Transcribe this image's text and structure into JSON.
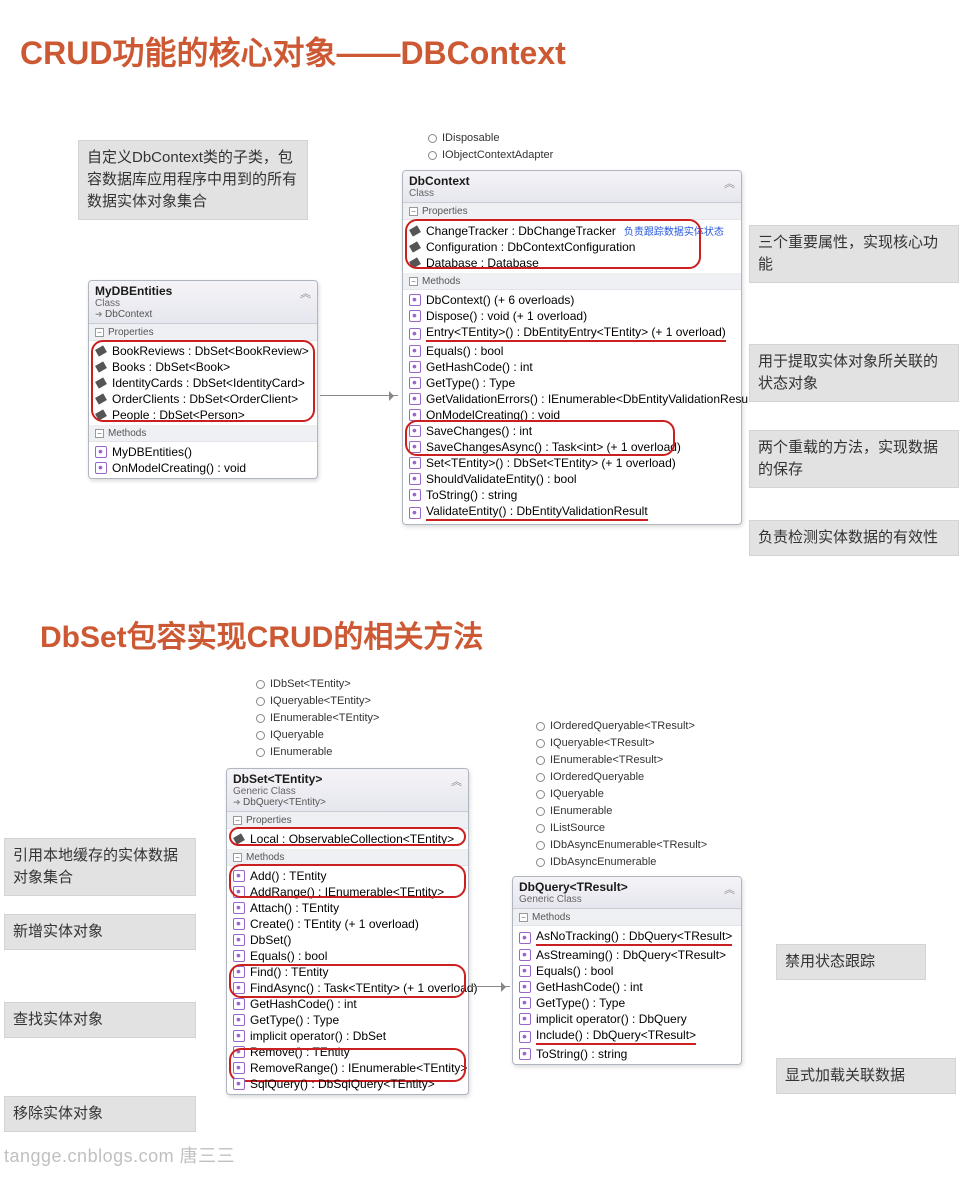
{
  "titles": {
    "main1": "CRUD功能的核心对象——DBContext",
    "main2": "DbSet包容实现CRUD的相关方法"
  },
  "footer": "tangge.cnblogs.com 唐三三",
  "callouts": {
    "c1": "自定义DbContext类的子类，包容数据库应用程序中用到的所有数据实体对象集合",
    "c2": "三个重要属性，实现核心功能",
    "c3": "用于提取实体对象所关联的状态对象",
    "c4": "两个重载的方法，实现数据的保存",
    "c5": "负责检测实体数据的有效性",
    "c6": "引用本地缓存的实体数据对象集合",
    "c7": "新增实体对象",
    "c8": "查找实体对象",
    "c9": "移除实体对象",
    "c10": "禁用状态跟踪",
    "c11": "显式加载关联数据"
  },
  "interfaces": {
    "dbcontext": [
      "IDisposable",
      "IObjectContextAdapter"
    ],
    "dbset": [
      "IDbSet<TEntity>",
      "IQueryable<TEntity>",
      "IEnumerable<TEntity>",
      "IQueryable",
      "IEnumerable"
    ],
    "dbquery": [
      "IOrderedQueryable<TResult>",
      "IQueryable<TResult>",
      "IEnumerable<TResult>",
      "IOrderedQueryable",
      "IQueryable",
      "IEnumerable",
      "IListSource",
      "IDbAsyncEnumerable<TResult>",
      "IDbAsyncEnumerable"
    ]
  },
  "uml": {
    "sectionProps": "Properties",
    "sectionMethods": "Methods",
    "myDbEntities": {
      "name": "MyDBEntities",
      "type": "Class",
      "inherits": "DbContext",
      "props": [
        "BookReviews : DbSet<BookReview>",
        "Books : DbSet<Book>",
        "IdentityCards : DbSet<IdentityCard>",
        "OrderClients : DbSet<OrderClient>",
        "People : DbSet<Person>"
      ],
      "methods": [
        "MyDBEntities()",
        "OnModelCreating() : void"
      ]
    },
    "dbContext": {
      "name": "DbContext",
      "type": "Class",
      "trackerAnno": "负责跟踪数据实体状态",
      "props": [
        "ChangeTracker : DbChangeTracker",
        "Configuration : DbContextConfiguration",
        "Database : Database"
      ],
      "methods": [
        "DbContext() (+ 6 overloads)",
        "Dispose() : void (+ 1 overload)",
        "Entry<TEntity>() : DbEntityEntry<TEntity> (+ 1 overload)",
        "Equals() : bool",
        "GetHashCode() : int",
        "GetType() : Type",
        "GetValidationErrors() : IEnumerable<DbEntityValidationResu",
        "OnModelCreating() : void",
        "SaveChanges() : int",
        "SaveChangesAsync() : Task<int> (+ 1 overload)",
        "Set<TEntity>() : DbSet<TEntity> (+ 1 overload)",
        "ShouldValidateEntity() : bool",
        "ToString() : string",
        "ValidateEntity() : DbEntityValidationResult"
      ]
    },
    "dbSet": {
      "name": "DbSet<TEntity>",
      "type": "Generic Class",
      "inherits": "DbQuery<TEntity>",
      "props": [
        "Local : ObservableCollection<TEntity>"
      ],
      "methods": [
        "Add() : TEntity",
        "AddRange() : IEnumerable<TEntity>",
        "Attach() : TEntity",
        "Create() : TEntity (+ 1 overload)",
        "DbSet()",
        "Equals() : bool",
        "Find() : TEntity",
        "FindAsync() : Task<TEntity> (+ 1 overload)",
        "GetHashCode() : int",
        "GetType() : Type",
        "implicit operator() : DbSet",
        "Remove() : TEntity",
        "RemoveRange() : IEnumerable<TEntity>",
        "SqlQuery() : DbSqlQuery<TEntity>"
      ]
    },
    "dbQuery": {
      "name": "DbQuery<TResult>",
      "type": "Generic Class",
      "methods": [
        "AsNoTracking() : DbQuery<TResult>",
        "AsStreaming() : DbQuery<TResult>",
        "Equals() : bool",
        "GetHashCode() : int",
        "GetType() : Type",
        "implicit operator() : DbQuery",
        "Include() : DbQuery<TResult>",
        "ToString() : string"
      ]
    }
  }
}
